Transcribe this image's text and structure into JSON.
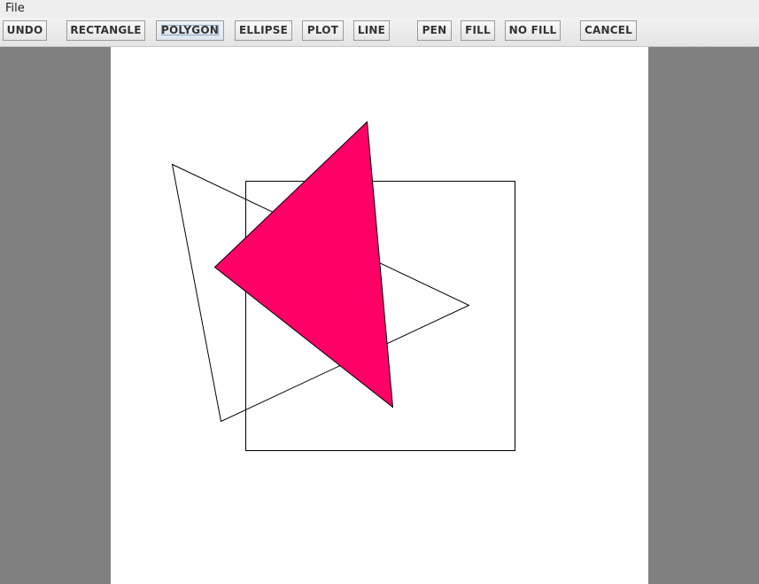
{
  "menu": {
    "file_label": "File"
  },
  "toolbar": {
    "buttons": [
      {
        "label": "UNDO"
      },
      {
        "label": "RECTANGLE"
      },
      {
        "label": "POLYGON"
      },
      {
        "label": "ELLIPSE"
      },
      {
        "label": "PLOT"
      },
      {
        "label": "LINE"
      },
      {
        "label": "PEN"
      },
      {
        "label": "FILL"
      },
      {
        "label": "NO FILL"
      },
      {
        "label": "CANCEL"
      }
    ],
    "selected_tool": "POLYGON"
  },
  "canvas": {
    "background_color": "#ffffff",
    "shapes": [
      {
        "type": "polygon",
        "fill": "none",
        "stroke": "#000000"
      },
      {
        "type": "rectangle",
        "fill": "none",
        "stroke": "#000000"
      },
      {
        "type": "polygon",
        "fill": "#ff0066",
        "stroke": "#000000"
      }
    ]
  },
  "colors": {
    "app_background": "#808080",
    "toolbar_background": "#eeeeee",
    "accent_fill": "#ff0066"
  }
}
